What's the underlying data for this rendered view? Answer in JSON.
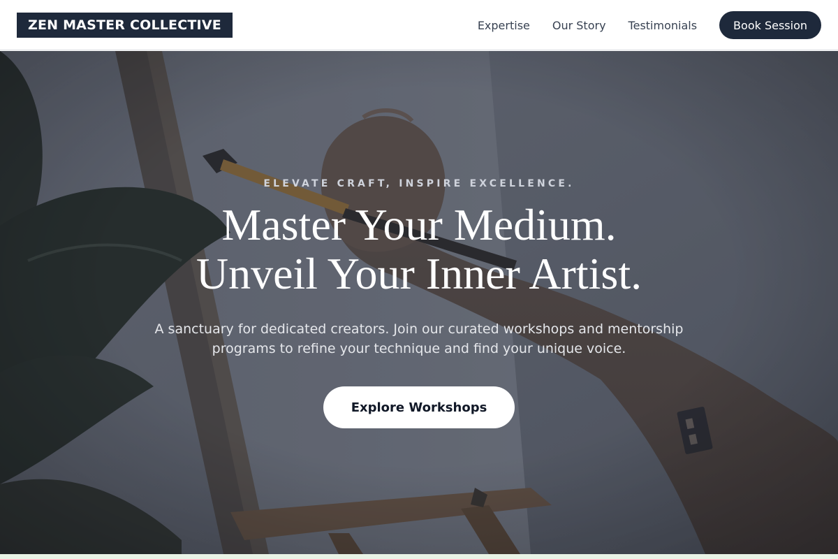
{
  "brand": {
    "name": "ZEN MASTER COLLECTIVE"
  },
  "nav": {
    "links": [
      "Expertise",
      "Our Story",
      "Testimonials"
    ],
    "cta_label": "Book Session"
  },
  "hero": {
    "eyebrow": "ELEVATE CRAFT, INSPIRE EXCELLENCE.",
    "headline_line1": "Master Your Medium.",
    "headline_line2": "Unveil Your Inner Artist.",
    "subtext": "A sanctuary for dedicated creators. Join our curated workshops and mentorship programs to refine your technique and find your unique voice.",
    "cta_label": "Explore Workshops",
    "background_image": "artist-painting-on-easel-photo"
  },
  "colors": {
    "brand_dark": "#1e293b",
    "white": "#ffffff",
    "nav_text": "#374151"
  }
}
